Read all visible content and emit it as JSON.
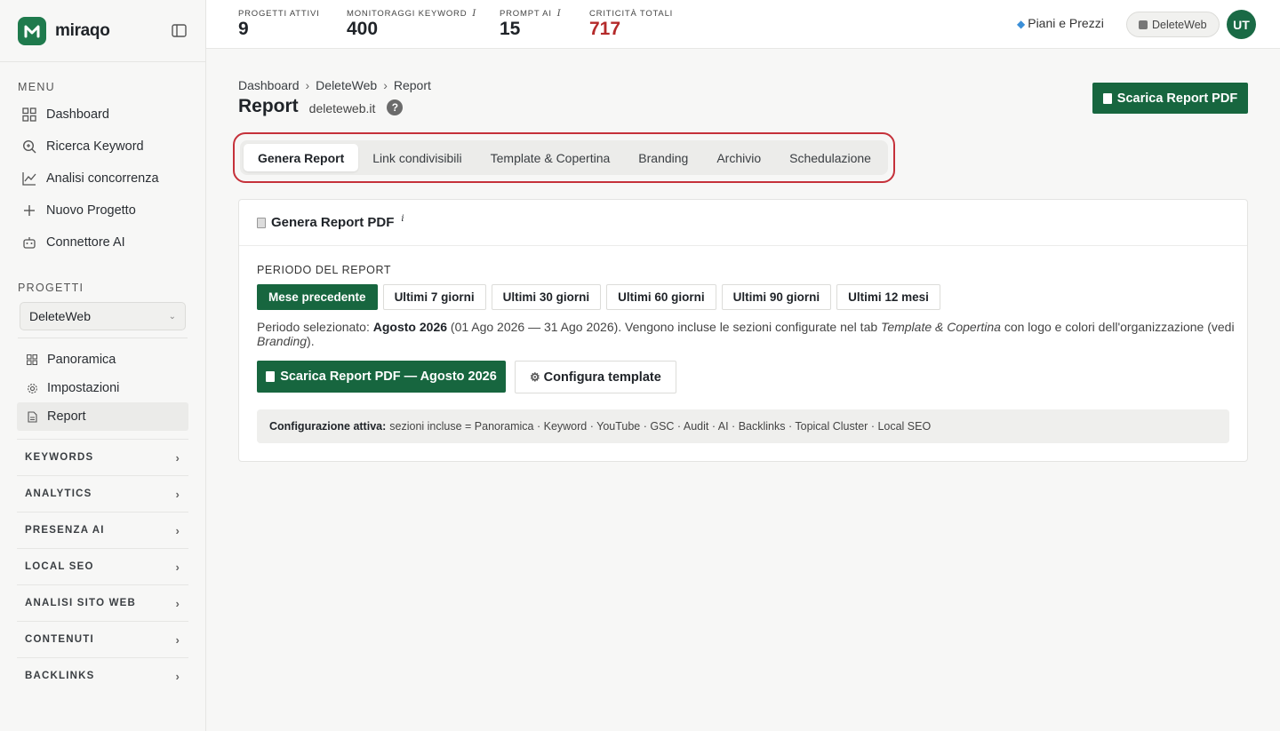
{
  "brand": {
    "name": "miraqo",
    "color": "#1f7a4d"
  },
  "sidebar": {
    "menu_label": "MENU",
    "menu": [
      {
        "label": "Dashboard",
        "icon": "grid-icon"
      },
      {
        "label": "Ricerca Keyword",
        "icon": "search-icon"
      },
      {
        "label": "Analisi concorrenza",
        "icon": "line-chart-icon"
      },
      {
        "label": "Nuovo Progetto",
        "icon": "plus-icon"
      },
      {
        "label": "Connettore AI",
        "icon": "robot-icon"
      }
    ],
    "projects_label": "PROGETTI",
    "project_selected": "DeleteWeb",
    "project_items": [
      {
        "label": "Panoramica",
        "icon": "grid-small-icon"
      },
      {
        "label": "Impostazioni",
        "icon": "gear-icon"
      },
      {
        "label": "Report",
        "icon": "document-icon",
        "active": true
      }
    ],
    "groups": [
      "KEYWORDS",
      "ANALYTICS",
      "PRESENZA AI",
      "LOCAL SEO",
      "ANALISI SITO WEB",
      "CONTENUTI",
      "BACKLINKS"
    ]
  },
  "topbar": {
    "stats": [
      {
        "label": "PROGETTI ATTIVI",
        "value": "9",
        "info": false
      },
      {
        "label": "MONITORAGGI KEYWORD",
        "value": "400",
        "info": true
      },
      {
        "label": "PROMPT AI",
        "value": "15",
        "info": true
      },
      {
        "label": "CRITICITÀ TOTALI",
        "value": "717",
        "info": false,
        "color": "#b42a2a"
      }
    ],
    "info_glyph": "i",
    "plans_label": "Piani e Prezzi",
    "workspace_label": "DeleteWeb",
    "avatar_initials": "UT"
  },
  "main": {
    "breadcrumb": [
      "Dashboard",
      "DeleteWeb",
      "Report"
    ],
    "breadcrumb_sep": "›",
    "title": "Report",
    "domain": "deleteweb.it",
    "help_glyph": "?",
    "download_button": "Scarica Report PDF",
    "tabs": [
      "Genera Report",
      "Link condivisibili",
      "Template & Copertina",
      "Branding",
      "Archivio",
      "Schedulazione"
    ],
    "active_tab": 0,
    "card": {
      "title": "Genera Report PDF",
      "info_glyph": "i",
      "period_label": "PERIODO DEL REPORT",
      "periods": [
        "Mese precedente",
        "Ultimi 7 giorni",
        "Ultimi 30 giorni",
        "Ultimi 60 giorni",
        "Ultimi 90 giorni",
        "Ultimi 12 mesi"
      ],
      "active_period": 0,
      "desc_prefix": "Periodo selezionato: ",
      "desc_period": "Agosto 2026",
      "desc_mid": " (01 Ago 2026 — 31 Ago 2026). Vengono incluse le sezioni configurate nel tab ",
      "desc_tab": "Template & Copertina",
      "desc_mid2": " con logo e colori dell'organizzazione (vedi ",
      "desc_branding": "Branding",
      "desc_suffix": ").",
      "download_label": "Scarica Report PDF — Agosto 2026",
      "configure_label": "Configura template",
      "config_title": "Configurazione attiva:",
      "config_text": "sezioni incluse = Panoramica · Keyword · YouTube · GSC · Audit · AI · Backlinks · Topical Cluster · Local SEO"
    }
  },
  "colors": {
    "primary": "#17663f",
    "highlight_outline": "#c5313a",
    "critical": "#b42a2a"
  }
}
